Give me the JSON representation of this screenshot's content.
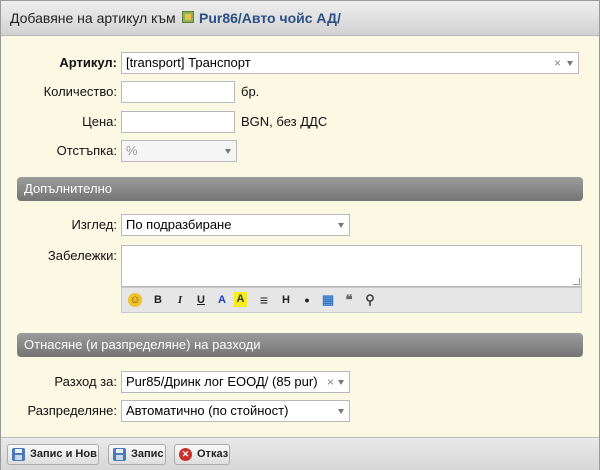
{
  "dialog": {
    "title": "Добавяне на артикул към",
    "title_link": "Pur86/Авто чойс АД/",
    "title_icon": "package-icon"
  },
  "form": {
    "article": {
      "label": "Артикул:",
      "value": "[transport] Транспорт",
      "clear": "×"
    },
    "quantity": {
      "label": "Количество:",
      "value": "",
      "unit": "бр."
    },
    "price": {
      "label": "Цена:",
      "value": "",
      "unit": "BGN, без ДДС"
    },
    "discount": {
      "label": "Отстъпка:",
      "value": "%"
    }
  },
  "section_additional": {
    "title": "Допълнително",
    "view": {
      "label": "Изглед:",
      "value": "По подразбиране"
    },
    "notes": {
      "label": "Забележки:",
      "value": ""
    },
    "editor_toolbar": [
      {
        "name": "emoji-icon",
        "glyph": "☺"
      },
      {
        "name": "bold-icon",
        "glyph": "B"
      },
      {
        "name": "italic-icon",
        "glyph": "I"
      },
      {
        "name": "underline-icon",
        "glyph": "U"
      },
      {
        "name": "text-color-icon",
        "glyph": "A"
      },
      {
        "name": "highlight-icon",
        "glyph": "A"
      },
      {
        "name": "align-icon",
        "glyph": "≡"
      },
      {
        "name": "heading-icon",
        "glyph": "H"
      },
      {
        "name": "bullet-icon",
        "glyph": "•"
      },
      {
        "name": "table-icon",
        "glyph": "▦"
      },
      {
        "name": "quote-icon",
        "glyph": "❝"
      },
      {
        "name": "attachment-icon",
        "glyph": "⚲"
      }
    ]
  },
  "section_costs": {
    "title": "Отнасяне (и разпределяне) на разходи",
    "expense": {
      "label": "Разход за:",
      "value": "Pur85/Дринк лог ЕООД/ (85 pur)",
      "clear": "×"
    },
    "allocation": {
      "label": "Разпределяне:",
      "value": "Автоматично (по стойност)"
    }
  },
  "footer": {
    "save_new": "Запис и Нов",
    "save": "Запис",
    "cancel": "Отказ"
  },
  "colors": {
    "section_header": "#8a8a8a",
    "body": "#fbf8e3",
    "title_link": "#2d4f86"
  }
}
